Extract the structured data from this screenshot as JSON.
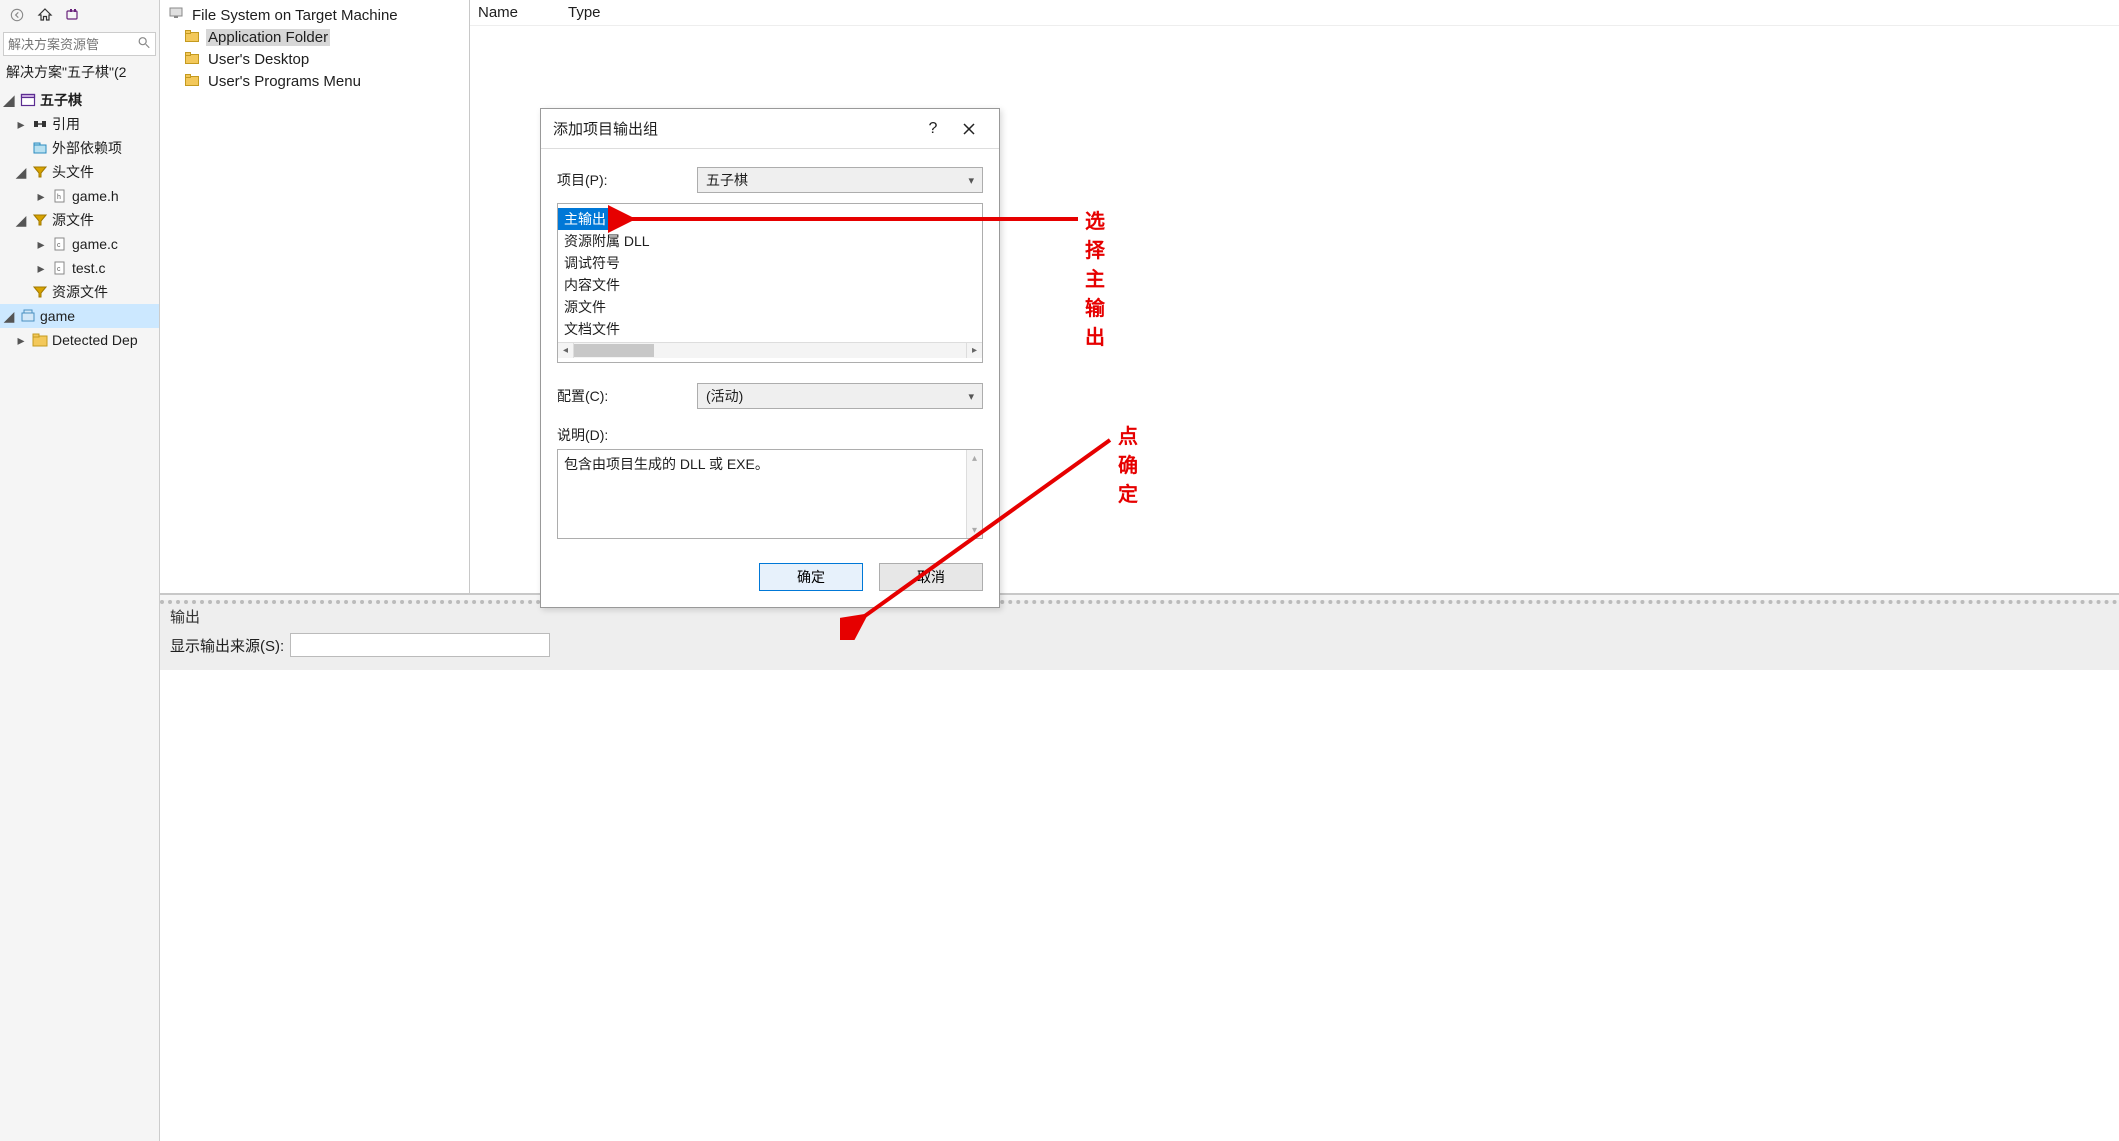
{
  "sidebar": {
    "search_placeholder": "解决方案资源管",
    "solution_line": "解决方案\"五子棋\"(2 ",
    "tree": {
      "project": "五子棋",
      "refs": "引用",
      "external": "外部依赖项",
      "headers": "头文件",
      "game_h": "game.h",
      "sources": "源文件",
      "game_c": "game.c",
      "test_c": "test.c",
      "resources": "资源文件",
      "game_proj2": "game",
      "detected": "Detected Dep"
    }
  },
  "mid": {
    "root": "File System on Target Machine",
    "items": [
      "Application Folder",
      "User's Desktop",
      "User's Programs Menu"
    ]
  },
  "right": {
    "col1": "Name",
    "col2": "Type"
  },
  "output": {
    "title": "输出",
    "src_label": "显示输出来源(S):"
  },
  "dialog": {
    "title": "添加项目输出组",
    "project_label": "项目(P):",
    "project_value": "五子棋",
    "list": [
      "主输出",
      "资源附属 DLL",
      "调试符号",
      "内容文件",
      "源文件",
      "文档文件"
    ],
    "config_label": "配置(C):",
    "config_value": "(活动)",
    "desc_label": "说明(D):",
    "desc_text": "包含由项目生成的 DLL 或 EXE。",
    "ok": "确定",
    "cancel": "取消"
  },
  "annot": {
    "a1": "选择 主输出",
    "a2": "点确定"
  }
}
